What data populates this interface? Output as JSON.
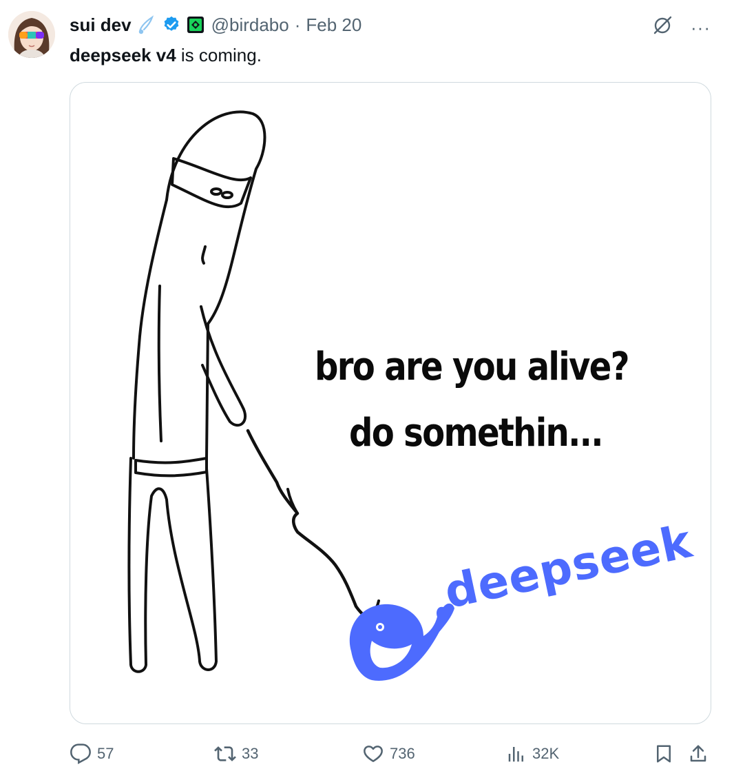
{
  "tweet": {
    "display_name": "sui dev",
    "handle": "@birdabo",
    "separator": "·",
    "date": "Feb 20",
    "text_bold": "deepseek v4",
    "text_rest": " is coming.",
    "more_label": "···"
  },
  "media": {
    "line1": "bro are you alive?",
    "line2": "do somethin...",
    "logo_word": "deepseek",
    "logo_color": "#4d6bfe"
  },
  "icons": {
    "after_name_1": "comet-icon",
    "after_name_2": "verified-badge-icon",
    "after_name_3": "affiliate-badge-icon",
    "top_right": "grok-icon"
  },
  "actions": {
    "replies": "57",
    "reposts": "33",
    "likes": "736",
    "views": "32K"
  },
  "colors": {
    "text": "#0f1419",
    "muted": "#536471",
    "verified": "#1d9bf0",
    "border": "#cfd9de"
  }
}
